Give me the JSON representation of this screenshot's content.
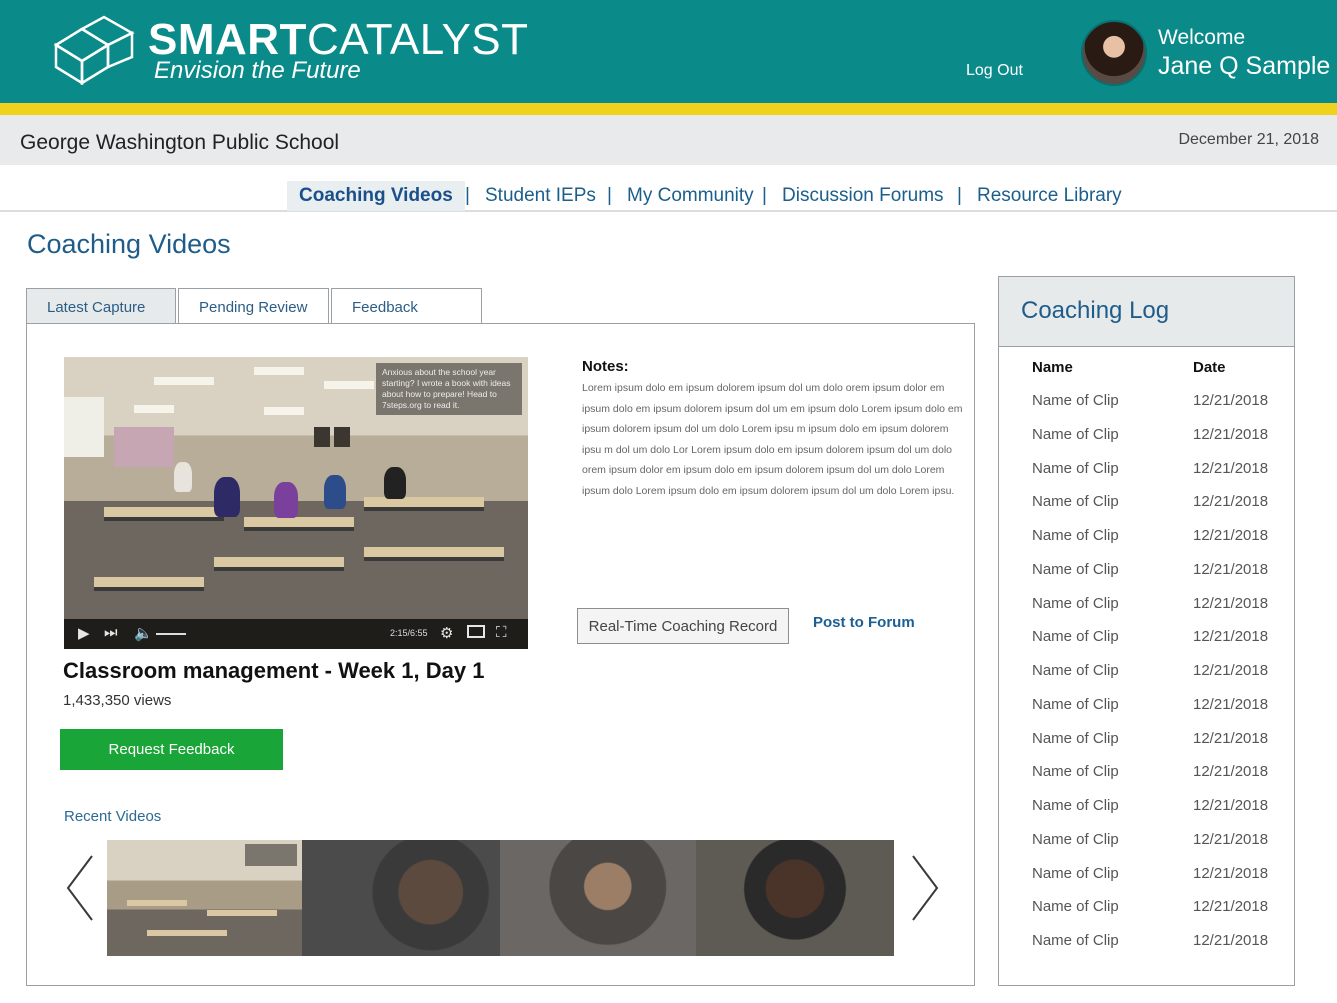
{
  "header": {
    "brand_bold": "SMART",
    "brand_light": "CATALYST",
    "tagline": "Envision the Future",
    "logout_label": "Log Out",
    "welcome": "Welcome",
    "user_name": "Jane Q Sample"
  },
  "school": {
    "name": "George Washington Public School",
    "date": "December 21, 2018"
  },
  "nav": {
    "items": [
      {
        "label": "Coaching Videos"
      },
      {
        "label": "Student IEPs"
      },
      {
        "label": "My Community"
      },
      {
        "label": "Discussion Forums"
      },
      {
        "label": "Resource Library"
      }
    ],
    "separator": "|"
  },
  "page": {
    "title": "Coaching Videos"
  },
  "tabs": [
    {
      "label": "Latest Capture"
    },
    {
      "label": "Pending Review"
    },
    {
      "label": "Feedback"
    }
  ],
  "video": {
    "overlay_text": "Anxious about the school year starting? I wrote a book with ideas about how to prepare! Head to 7steps.org to read it.",
    "timecode": "2:15/6:55",
    "title": "Classroom management - Week 1, Day 1",
    "views": "1,433,350 views",
    "request_feedback_label": "Request Feedback"
  },
  "notes": {
    "label": "Notes:",
    "body": "Lorem ipsum dolo em ipsum dolorem ipsum dol um dolo  orem ipsum dolor em ipsum dolo em ipsum dolorem ipsum dol um em ipsum dolo Lorem ipsum dolo em ipsum dolorem ipsum dol um dolo Lorem ipsu m ipsum dolo em ipsum dolorem ipsu m dol um dolo Lor  Lorem ipsum dolo em ipsum dolorem ipsum dol um dolo  orem ipsum dolor em ipsum dolo em ipsum dolorem ipsum dol um dolo Lorem ipsum dolo Lorem ipsum dolo em ipsum dolorem ipsum dol um dolo Lorem ipsu."
  },
  "actions": {
    "rtc_label": "Real-Time Coaching Record",
    "post_forum_label": "Post to Forum"
  },
  "recent": {
    "label": "Recent Videos"
  },
  "log": {
    "title": "Coaching Log",
    "col_name": "Name",
    "col_date": "Date",
    "rows": [
      {
        "name": "Name of Clip",
        "date": "12/21/2018"
      },
      {
        "name": "Name of Clip",
        "date": "12/21/2018"
      },
      {
        "name": "Name of Clip",
        "date": "12/21/2018"
      },
      {
        "name": "Name of Clip",
        "date": "12/21/2018"
      },
      {
        "name": "Name of Clip",
        "date": "12/21/2018"
      },
      {
        "name": "Name of Clip",
        "date": "12/21/2018"
      },
      {
        "name": "Name of Clip",
        "date": "12/21/2018"
      },
      {
        "name": "Name of Clip",
        "date": "12/21/2018"
      },
      {
        "name": "Name of Clip",
        "date": "12/21/2018"
      },
      {
        "name": "Name of Clip",
        "date": "12/21/2018"
      },
      {
        "name": "Name of Clip",
        "date": "12/21/2018"
      },
      {
        "name": "Name of Clip",
        "date": "12/21/2018"
      },
      {
        "name": "Name of Clip",
        "date": "12/21/2018"
      },
      {
        "name": "Name of Clip",
        "date": "12/21/2018"
      },
      {
        "name": "Name of Clip",
        "date": "12/21/2018"
      },
      {
        "name": "Name of Clip",
        "date": "12/21/2018"
      },
      {
        "name": "Name of Clip",
        "date": "12/21/2018"
      }
    ]
  },
  "colors": {
    "header_teal": "#0b8a8a",
    "accent_yellow": "#f0d21e",
    "link_blue": "#1f5c8a",
    "button_green": "#1aa538"
  }
}
